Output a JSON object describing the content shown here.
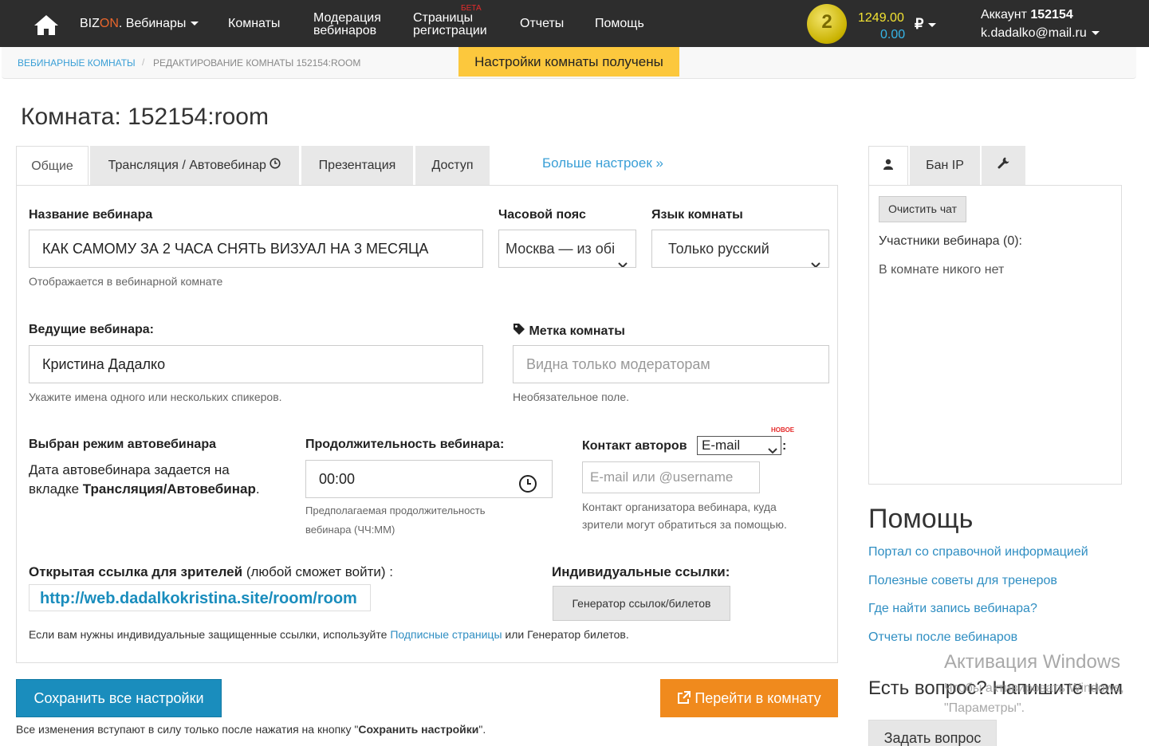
{
  "nav": {
    "brand_prefix": "BIZ",
    "brand_on": "ON",
    "brand_suffix": ". Вебинары",
    "rooms": "Комнаты",
    "moderation_line1": "Модерация",
    "moderation_line2": "вебинаров",
    "pages_line1": "Страницы",
    "pages_line2": "регистрации",
    "pages_badge": "БЕТА",
    "reports": "Отчеты",
    "help": "Помощь",
    "level": "2",
    "balance_main": "1249.00",
    "balance_bonus": "0.00",
    "currency": "₽",
    "account_label": "Аккаунт",
    "account_id": "152154",
    "account_email": "k.dadalko@mail.ru"
  },
  "breadcrumb": {
    "root": "Вебинарные комнаты",
    "separator": "/",
    "current": "Редактирование комнаты 152154:room"
  },
  "toast": "Настройки комнаты получены",
  "page_title": "Комната: 152154:room",
  "tabs": {
    "general": "Общие",
    "broadcast": "Трансляция / Автовебинар",
    "presentation": "Презентация",
    "access": "Доступ",
    "more": "Больше настроек »"
  },
  "form": {
    "webinar_name_label": "Название вебинара",
    "webinar_name_value": "КАК САМОМУ  ЗА 2 ЧАСА СНЯТЬ  ВИЗУАЛ НА 3 МЕСЯЦА",
    "webinar_name_help": "Отображается в вебинарной комнате",
    "timezone_label": "Часовой пояс",
    "timezone_value": "Москва — из обі",
    "language_label": "Язык комнаты",
    "language_value": "Только русский",
    "hosts_label": "Ведущие вебинара:",
    "hosts_value": "Кристина Дадалко",
    "hosts_help": "Укажите имена одного или нескольких спикеров.",
    "tag_label": "Метка комнаты",
    "tag_placeholder": "Видна только модераторам",
    "tag_help": "Необязательное поле.",
    "mode_title": "Выбран режим автовебинара",
    "mode_text_1": "Дата автовебинара задается на",
    "mode_text_2": "вкладке",
    "mode_text_bold": "Трансляция/Автовебинар",
    "mode_text_end": ".",
    "duration_label": "Продолжительность вебинара:",
    "duration_value": "00:00",
    "duration_help_1": "Предполагаемая продолжительность",
    "duration_help_2": "вебинара (ЧЧ:ММ)",
    "contact_label": "Контакт авторов",
    "contact_colon": ":",
    "contact_type": "E-mail",
    "contact_new_badge": "НОВОЕ",
    "contact_placeholder": "E-mail или @username",
    "contact_help_1": "Контакт организатора вебинара, куда",
    "contact_help_2": "зрители могут обратиться за помощью.",
    "open_link_label": "Открытая ссылка для зрителей",
    "open_link_note": "(любой сможет войти) :",
    "open_link_value": "http://web.dadalkokristina.site/room/room",
    "individual_links_label": "Индивидуальные ссылки:",
    "generator_button": "Генератор ссылок/билетов",
    "links_note_1": "Если вам нужны индивидуальные защищенные ссылки, используйте",
    "links_note_link": "Подписные страницы",
    "links_note_2": "или Генератор билетов."
  },
  "right": {
    "tab_ban": "Бан IP",
    "clear_chat": "Очистить чат",
    "participants": "Участники вебинара (0):",
    "empty": "В комнате никого нет"
  },
  "help": {
    "title": "Помощь",
    "links": [
      "Портал со справочной информацией",
      "Полезные советы для тренеров",
      "Где найти запись вебинара?",
      "Отчеты после вебинаров"
    ],
    "ask_title": "Есть вопрос? Напишите нам",
    "ask_button": "Задать вопрос"
  },
  "watermark": {
    "title": "Активация Windows",
    "line1": "Чтобы активировать Windows,",
    "line2": "\"Параметры\"."
  },
  "actions": {
    "save": "Сохранить все настройки",
    "go": "Перейти в комнату",
    "note_prefix": "Все изменения вступают в силу только после нажатия на кнопку \"",
    "note_bold": "Сохранить настройки",
    "note_suffix": "\"."
  },
  "colors": {
    "nav_bg": "#2d2d2d",
    "accent_blue": "#1a8dbd",
    "accent_orange": "#f08a1d",
    "toast_bg": "#fcc83d",
    "link": "#2f8ec2"
  }
}
